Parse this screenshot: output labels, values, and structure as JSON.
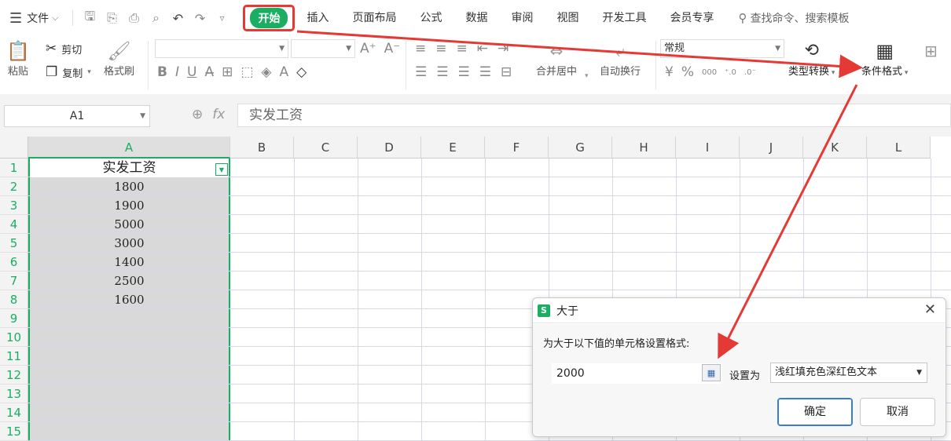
{
  "menu": {
    "file_label": "文件",
    "tabs": [
      "开始",
      "插入",
      "页面布局",
      "公式",
      "数据",
      "审阅",
      "视图",
      "开发工具",
      "会员专享"
    ],
    "search_placeholder": "查找命令、搜索模板"
  },
  "ribbon": {
    "paste_label": "粘贴",
    "cut_label": "剪切",
    "copy_label": "复制",
    "format_painter_label": "格式刷",
    "number_format": "常规",
    "merge_label": "合并居中",
    "wrap_label": "自动换行",
    "type_convert_label": "类型转换",
    "conditional_format_label": "条件格式"
  },
  "formula_bar": {
    "name_box": "A1",
    "fx_label": "fx",
    "content": "实发工资"
  },
  "sheet": {
    "columns": [
      "A",
      "B",
      "C",
      "D",
      "E",
      "F",
      "G",
      "H",
      "I",
      "J",
      "K",
      "L"
    ],
    "rows": [
      "1",
      "2",
      "3",
      "4",
      "5",
      "6",
      "7",
      "8",
      "9",
      "10",
      "11",
      "12",
      "13",
      "14",
      "15"
    ],
    "column_a": [
      "实发工资",
      "1800",
      "1900",
      "5000",
      "3000",
      "1400",
      "2500",
      "1600"
    ]
  },
  "dialog": {
    "app_icon": "S",
    "title": "大于",
    "prompt": "为大于以下值的单元格设置格式:",
    "value": "2000",
    "set_as_label": "设置为",
    "format_option": "浅红填充色深红色文本",
    "ok_label": "确定",
    "cancel_label": "取消"
  },
  "colors": {
    "accent": "#1aae63",
    "highlight": "#e53935",
    "dialog_focus": "#3a7bd5"
  }
}
